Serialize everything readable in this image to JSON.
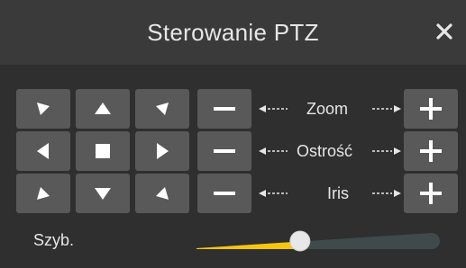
{
  "dialog": {
    "title": "Sterowanie PTZ",
    "close_icon": "close-icon"
  },
  "pad": {
    "buttons": [
      {
        "name": "pan-up-left",
        "icon": "triangle-up-left-icon"
      },
      {
        "name": "pan-up",
        "icon": "triangle-up-icon"
      },
      {
        "name": "pan-up-right",
        "icon": "triangle-up-right-icon"
      },
      {
        "name": "pan-left",
        "icon": "triangle-left-icon"
      },
      {
        "name": "stop",
        "icon": "square-stop-icon"
      },
      {
        "name": "pan-right",
        "icon": "triangle-right-icon"
      },
      {
        "name": "pan-down-left",
        "icon": "triangle-down-left-icon"
      },
      {
        "name": "pan-down",
        "icon": "triangle-down-icon"
      },
      {
        "name": "pan-down-right",
        "icon": "triangle-down-right-icon"
      }
    ]
  },
  "controls": [
    {
      "label": "Zoom"
    },
    {
      "label": "Ostrość"
    },
    {
      "label": "Iris"
    }
  ],
  "speed": {
    "label": "Szyb.",
    "level": 0.44
  },
  "colors": {
    "background": "#2f2f2f",
    "titlebar": "#3a3a3a",
    "button": "#595959",
    "accent_yellow": "#f5c60f",
    "track": "#3f4a4a",
    "text": "#e6e6e6"
  }
}
